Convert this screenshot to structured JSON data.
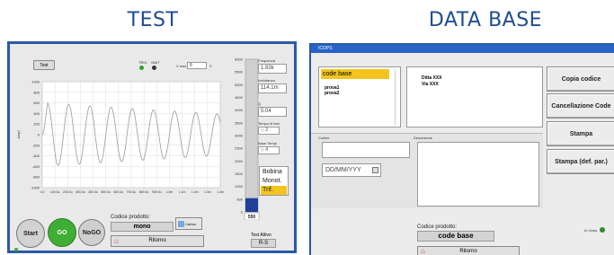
{
  "headings": {
    "left": "TEST",
    "right": "DATA BASE"
  },
  "test": {
    "test_button": "Test",
    "trig_label": "TRIG",
    "wait_label": "WAIT",
    "vmax_label": "V max",
    "vmax_value": "8",
    "vmax_unit": "V",
    "y_axis_label": "Ampl",
    "chart_data": {
      "type": "line",
      "title": "",
      "ylabel": "Ampl",
      "xlabel": "",
      "ylim": [
        -1000,
        1000
      ],
      "y_ticks": [
        "1000",
        "800",
        "600",
        "400",
        "200",
        "0",
        "-200",
        "-400",
        "-600",
        "-800",
        "-1000"
      ],
      "x_ticks": [
        "0.0",
        "100.0u",
        "200.0u",
        "300.0u",
        "400.0u",
        "500.0u",
        "600.0u",
        "700.0u",
        "800.0u",
        "900.0u",
        "1.0m",
        "1.1m",
        "1.2m",
        "1.3m",
        "1.4m"
      ],
      "series": [
        {
          "cycles": 8.4,
          "amplitude": 600,
          "decay": 0.35,
          "color": "#9a9a9a"
        }
      ]
    },
    "bar_scale": [
      "6000",
      "5500",
      "5000",
      "4500",
      "4000",
      "3500",
      "3000",
      "2500",
      "2000",
      "1500",
      "1000",
      "500",
      "0"
    ],
    "bar_value": "550",
    "bar_fill_fraction": 0.09,
    "fields": [
      {
        "label": "Frequenza",
        "value": "1.83k"
      },
      {
        "label": "Induttanza",
        "value": "114.1m"
      },
      {
        "label": "Q",
        "value": "5.04"
      },
      {
        "label": "Tempo di test",
        "value": "2"
      },
      {
        "label": "Base Tempi",
        "value": "4"
      }
    ],
    "legend": [
      "Bobina",
      "Monot.",
      "Trif."
    ],
    "legend_selected": 2,
    "start_label": "Start",
    "go_label": "GO",
    "nogo_label": "NoGO",
    "codice_label": "Codice prodotto:",
    "codice_value": "mono",
    "carica_label": "Carica",
    "ritorno_label": "Ritorno",
    "test_attivo_label": "Test Attivo",
    "test_attivo_value": "R-S"
  },
  "db": {
    "window_title": "ICOPS",
    "list_header": "code base",
    "list_items": [
      "prova1",
      "prova2"
    ],
    "info_lines": [
      "Ditta XXX",
      "Via XXX"
    ],
    "buttons": [
      "Copia codice",
      "Cancellazione Code",
      "Stampa",
      "Stampa (def. par.)"
    ],
    "codice_label": "Codice",
    "descrizione_label": "Descrizione",
    "date_placeholder": "DD/MM/YYY",
    "codice_prodotto_label": "Codice prodotto:",
    "codice_prodotto_value": "code base",
    "ritorno_label": "Ritorno",
    "in_linea_label": "In Linea"
  },
  "colors": {
    "accent": "#2a5aa8",
    "heading": "#1f4d8f",
    "go_green": "#3fae35",
    "bar_fill": "#1f3f9a",
    "legend_select": "#f3c51c"
  }
}
